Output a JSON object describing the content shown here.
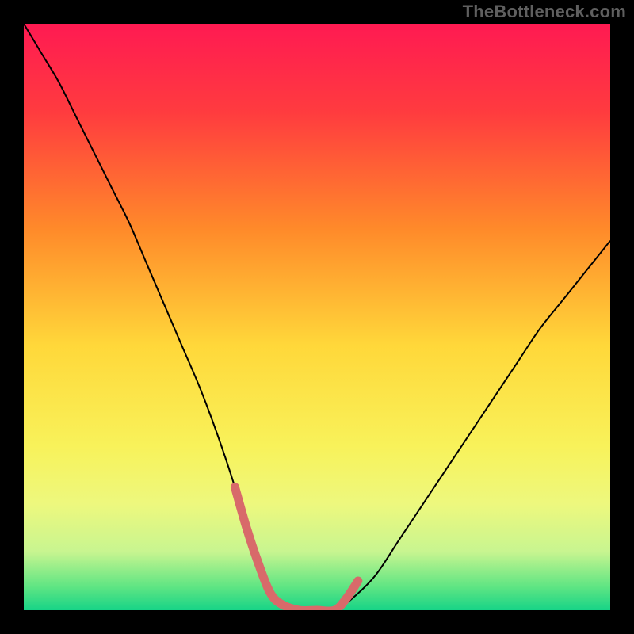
{
  "watermark": "TheBottleneck.com",
  "chart_data": {
    "type": "line",
    "title": "",
    "xlabel": "",
    "ylabel": "",
    "xlim": [
      0,
      100
    ],
    "ylim": [
      0,
      100
    ],
    "background_gradient": {
      "stops": [
        {
          "offset": 0,
          "color": "#ff1a52"
        },
        {
          "offset": 15,
          "color": "#ff3b3f"
        },
        {
          "offset": 35,
          "color": "#ff8a2a"
        },
        {
          "offset": 55,
          "color": "#ffd83a"
        },
        {
          "offset": 72,
          "color": "#f8f25a"
        },
        {
          "offset": 82,
          "color": "#edf87e"
        },
        {
          "offset": 90,
          "color": "#c8f590"
        },
        {
          "offset": 96,
          "color": "#5fe583"
        },
        {
          "offset": 100,
          "color": "#17d487"
        }
      ]
    },
    "series": [
      {
        "name": "bottleneck-curve",
        "stroke": "#000000",
        "stroke_width": 2,
        "x": [
          0,
          3,
          6,
          9,
          12,
          15,
          18,
          21,
          24,
          27,
          30,
          33,
          36,
          38,
          40,
          42,
          44,
          47,
          50,
          53,
          56,
          60,
          64,
          68,
          72,
          76,
          80,
          84,
          88,
          92,
          96,
          100
        ],
        "values": [
          100,
          95,
          90,
          84,
          78,
          72,
          66,
          59,
          52,
          45,
          38,
          30,
          21,
          14,
          8,
          3,
          1,
          0,
          0,
          0,
          2,
          6,
          12,
          18,
          24,
          30,
          36,
          42,
          48,
          53,
          58,
          63
        ]
      },
      {
        "name": "valley-highlight",
        "stroke": "#d86a6a",
        "stroke_width": 11,
        "linecap": "round",
        "x": [
          36,
          38,
          40,
          42,
          44,
          47,
          50,
          53,
          55,
          57
        ],
        "values": [
          21,
          14,
          8,
          3,
          1,
          0,
          0,
          0,
          2,
          5
        ]
      }
    ]
  }
}
